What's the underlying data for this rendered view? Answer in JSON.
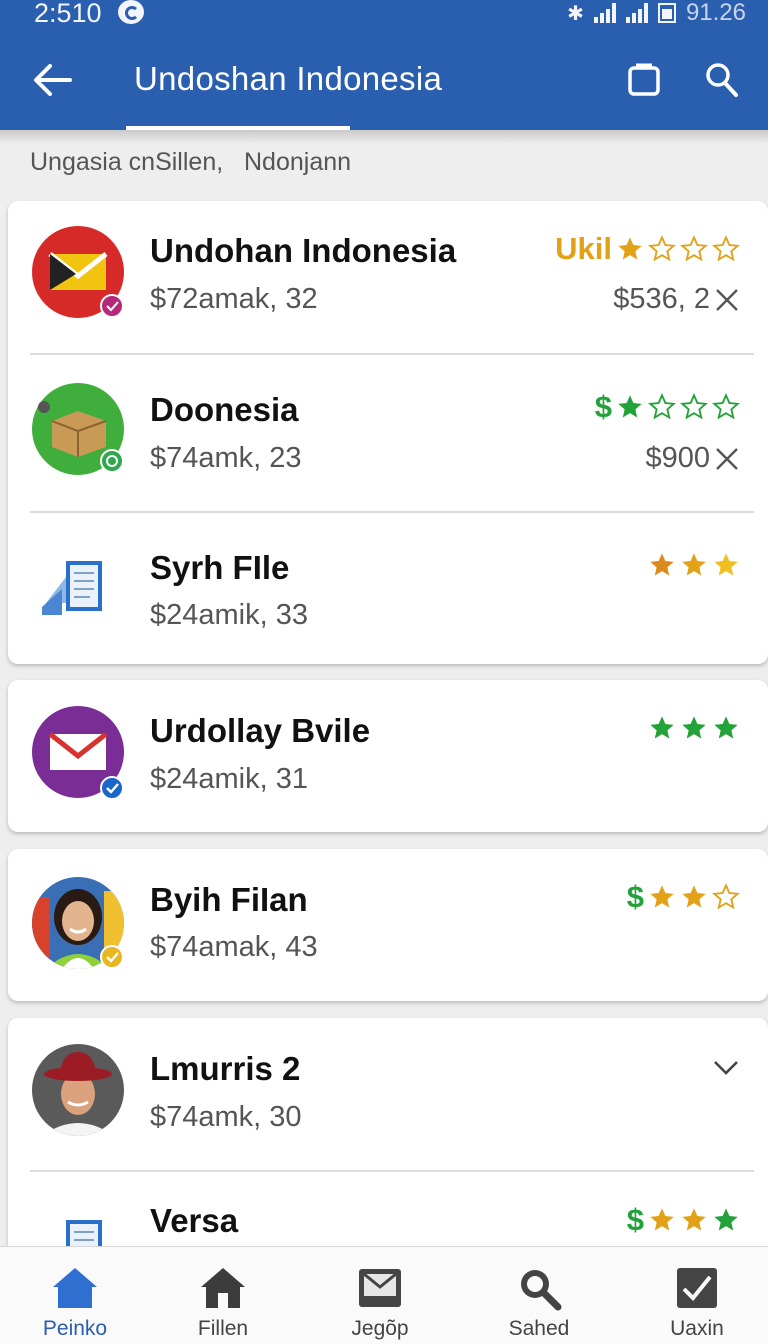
{
  "status_bar": {
    "time": "2:510",
    "battery_text": "91.26"
  },
  "app_bar": {
    "title": "Undoshan Indonesia",
    "icons": [
      "back-arrow-icon",
      "square-icon",
      "search-icon"
    ]
  },
  "breadcrumb": "Ungasia cnSillen,   Ndonjann",
  "colors": {
    "primary": "#2a5fb0",
    "gold": "#e3a117",
    "green": "#22a33a",
    "grey_star": "#bbbbbb"
  },
  "list": [
    {
      "title": "Undohan Indonesia",
      "subtitle": "$72amak, 32",
      "right_label": "Ukil",
      "right_label_color": "#e3a117",
      "rating": 1,
      "star_style": "gold",
      "price": "$536, 2",
      "has_close": true,
      "avatar": "red-envelope-icon",
      "badge": "pink"
    },
    {
      "title": "Doonesia",
      "subtitle": "$74amk, 23",
      "right_label": "$",
      "right_label_color": "#22a33a",
      "rating": 1,
      "star_style": "green",
      "price": "$900",
      "has_close": true,
      "avatar": "green-box-icon",
      "badge": "green"
    },
    {
      "title": "Syrh FIle",
      "subtitle": "$24amik, 33",
      "right_label": "",
      "rating": 3,
      "star_style": "gold",
      "price": "",
      "has_close": false,
      "avatar": "blue-document-icon",
      "badge": ""
    },
    {
      "title": "Urdollay Bvile",
      "subtitle": "$24amik, 31",
      "right_label": "",
      "rating": 3,
      "star_style": "green",
      "price": "",
      "has_close": false,
      "avatar": "purple-envelope-icon",
      "badge": "blue"
    },
    {
      "title": "Byih FiIan",
      "subtitle": "$74amak, 43",
      "right_label": "$",
      "right_label_color": "#22a33a",
      "rating": 2,
      "star_style": "gold",
      "price": "",
      "has_close": false,
      "avatar": "woman-photo-avatar",
      "badge": "gold"
    },
    {
      "title": "Lmurris 2",
      "subtitle": "$74amk, 30",
      "right_label": "",
      "rating": 0,
      "star_style": "",
      "price": "",
      "has_close": false,
      "has_chevron": true,
      "avatar": "man-hat-photo-avatar",
      "badge": ""
    },
    {
      "title": "Versa",
      "subtitle": "",
      "right_label": "$",
      "right_label_color": "#22a33a",
      "rating": 3,
      "star_style": "gold-green",
      "price": "",
      "has_close": false,
      "avatar": "blue-document-icon",
      "badge": ""
    }
  ],
  "bottom_nav": [
    {
      "label": "Peinko",
      "icon": "home-icon",
      "active": true
    },
    {
      "label": "Fillen",
      "icon": "home-icon",
      "active": false
    },
    {
      "label": "Jegõp",
      "icon": "mail-tray-icon",
      "active": false
    },
    {
      "label": "Sahed",
      "icon": "search-icon",
      "active": false
    },
    {
      "label": "Uaxin",
      "icon": "checkbox-icon",
      "active": false
    }
  ]
}
